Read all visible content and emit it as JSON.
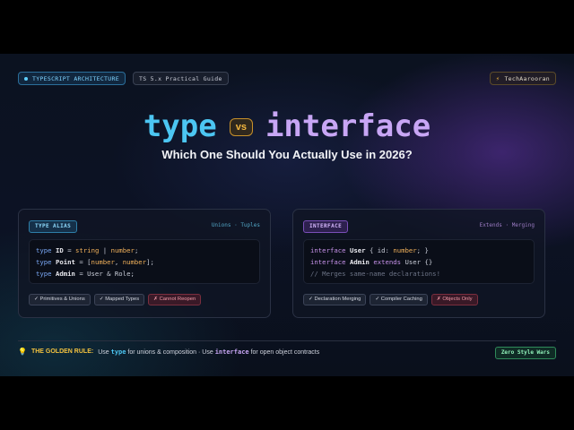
{
  "header": {
    "category_chip": "TYPESCRIPT ARCHITECTURE",
    "version_chip": "TS 5.x Practical Guide",
    "author": "TechAarooran"
  },
  "hero": {
    "left_word": "type",
    "vs": "vs",
    "right_word": "interface",
    "subtitle": "Which One Should You Actually Use in 2026?"
  },
  "cards": {
    "alias": {
      "tag": "TYPE ALIAS",
      "hint": "Unions · Tuples",
      "pills": [
        "✓ Primitives & Unions",
        "✓ Mapped Types",
        "✗ Cannot Reopen"
      ]
    },
    "interface": {
      "tag": "INTERFACE",
      "hint": "Extends · Merging",
      "pills": [
        "✓ Declaration Merging",
        "✓ Compiler Caching",
        "✗ Objects Only"
      ]
    }
  },
  "code": {
    "alias_line1": {
      "kw": "type",
      "name": "ID",
      "eq": "=",
      "t1": "string",
      "bar": "|",
      "t2": "number",
      "end": ";"
    },
    "alias_line2": {
      "kw": "type",
      "name": "Point",
      "rest": "= [",
      "t1": "number",
      "comma": ", ",
      "t2": "number",
      "end": "];"
    },
    "alias_line3": {
      "kw": "type",
      "name": "Admin",
      "rest": "= User & Role;"
    },
    "iface_line1": {
      "kw": "interface",
      "name": "User",
      "open": "{ id:",
      "t1": "number",
      "close": "; }"
    },
    "iface_line2": {
      "kw": "interface",
      "name": "Admin",
      "kw2": "extends",
      "rest": "User {}"
    },
    "iface_line3": "// Merges same-name declarations!"
  },
  "footer": {
    "rule_label": "THE GOLDEN RULE:",
    "use1": "Use",
    "kw_type": "type",
    "mid": "for unions & composition · Use",
    "kw_interface": "interface",
    "end": "for open object contracts",
    "badge": "Zero Style Wars"
  },
  "colors": {
    "type_accent": "#4cc6f2",
    "interface_accent": "#c8a6f5",
    "vs_gold": "#f3b63f",
    "bad_red": "#f19aa8",
    "ok_green": "#8ff0b8"
  },
  "icons": {
    "category_dot": "dot-icon",
    "author": "bolt-icon",
    "rule": "lightbulb-icon"
  }
}
